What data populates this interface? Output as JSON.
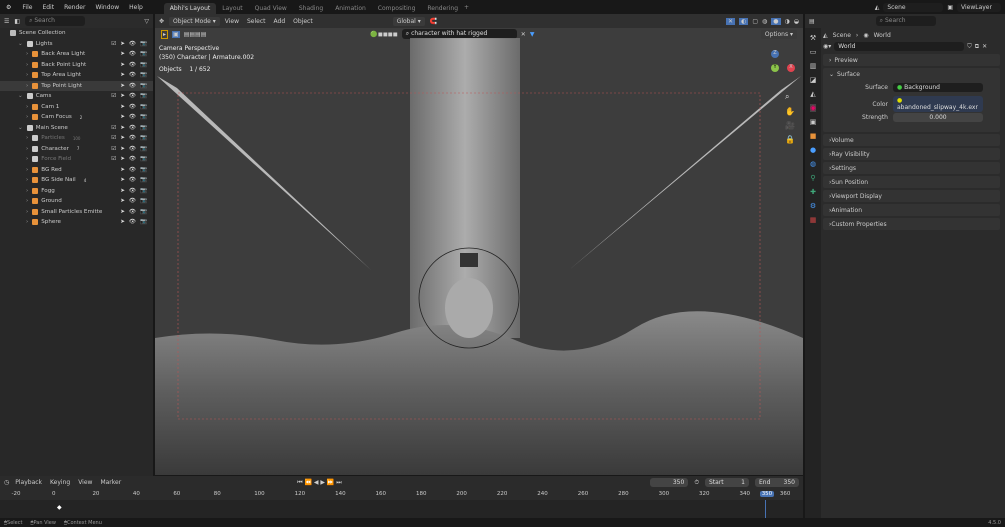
{
  "menu": [
    "File",
    "Edit",
    "Render",
    "Window",
    "Help"
  ],
  "workspaces": [
    "Abhi's Layout",
    "Layout",
    "Quad View",
    "Shading",
    "Animation",
    "Compositing",
    "Rendering"
  ],
  "scene": "Scene",
  "view_layer": "ViewLayer",
  "outliner": {
    "search_placeholder": "Search",
    "root": "Scene Collection",
    "rows": [
      {
        "name": "Lights",
        "type": "collection",
        "depth": 1
      },
      {
        "name": "Back Area Light",
        "type": "light",
        "depth": 2
      },
      {
        "name": "Back Point Light",
        "type": "light",
        "depth": 2
      },
      {
        "name": "Top Area Light",
        "type": "light",
        "depth": 2
      },
      {
        "name": "Top Point Light",
        "type": "light",
        "depth": 2,
        "selected": true
      },
      {
        "name": "Cams",
        "type": "collection",
        "depth": 1
      },
      {
        "name": "Cam 1",
        "type": "camera",
        "depth": 2
      },
      {
        "name": "Cam Focus",
        "type": "empty",
        "depth": 2,
        "badge": "2"
      },
      {
        "name": "Main Scene",
        "type": "collection",
        "depth": 1
      },
      {
        "name": "Particles",
        "type": "collection",
        "depth": 2,
        "disabled": true,
        "badge": "100"
      },
      {
        "name": "Character",
        "type": "collection",
        "depth": 2,
        "badge": "7"
      },
      {
        "name": "Force Field",
        "type": "collection",
        "depth": 2,
        "disabled": true
      },
      {
        "name": "BG Red",
        "type": "mesh",
        "depth": 2
      },
      {
        "name": "BG Side Nail",
        "type": "mesh",
        "depth": 2,
        "badge": "4"
      },
      {
        "name": "Fogg",
        "type": "mesh",
        "depth": 2
      },
      {
        "name": "Ground",
        "type": "mesh",
        "depth": 2
      },
      {
        "name": "Small Particles Emitte",
        "type": "mesh",
        "depth": 2
      },
      {
        "name": "Sphere",
        "type": "mesh",
        "depth": 2
      }
    ]
  },
  "viewport": {
    "mode": "Object Mode",
    "menus": [
      "View",
      "Select",
      "Add",
      "Object"
    ],
    "orientation": "Global",
    "search": "character with hat rigged",
    "options": "Options",
    "overlay": [
      "Camera Perspective",
      "(350) Character | Armature.002"
    ],
    "objects_label": "Objects",
    "objects_value": "1 / 652",
    "gizmo": {
      "x": "X",
      "y": "Y",
      "z": "Z"
    }
  },
  "properties": {
    "search_placeholder": "Search",
    "breadcrumb": [
      "Scene",
      "World"
    ],
    "world_name": "World",
    "sections": [
      "Preview",
      "Surface"
    ],
    "surface": {
      "surface_label": "Surface",
      "surface_value": "Background",
      "color_label": "Color",
      "color_value": "abandoned_slipway_4k.exr",
      "strength_label": "Strength",
      "strength_value": "0.000"
    },
    "more_sections": [
      "Volume",
      "Ray Visibility",
      "Settings",
      "Sun Position",
      "Viewport Display",
      "Animation",
      "Custom Properties"
    ]
  },
  "timeline": {
    "menus": [
      "Playback",
      "Keying",
      "View",
      "Marker"
    ],
    "current_frame": "350",
    "start_label": "Start",
    "start": "1",
    "end_label": "End",
    "end": "350",
    "ticks": [
      "-20",
      "0",
      "20",
      "40",
      "60",
      "80",
      "100",
      "120",
      "140",
      "160",
      "180",
      "200",
      "220",
      "240",
      "260",
      "280",
      "300",
      "320",
      "340",
      "350",
      "360"
    ]
  },
  "status": {
    "items": [
      "Select",
      "Pan View",
      "Context Menu"
    ],
    "version": "4.5.0"
  },
  "colors": {
    "accent": "#4772b3",
    "light_orange": "#e8923a",
    "mesh_orange": "#e8923a",
    "data_green": "#3fa87a"
  }
}
